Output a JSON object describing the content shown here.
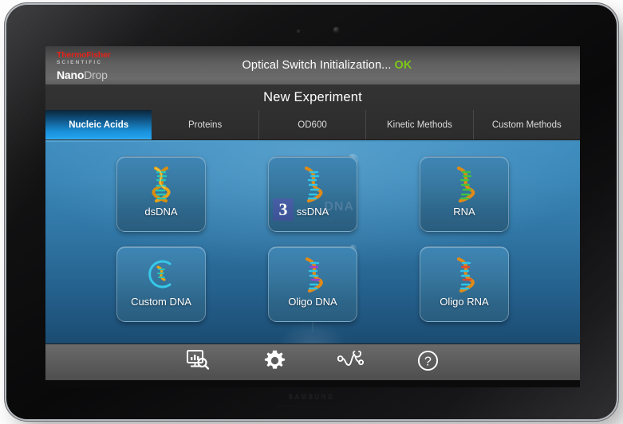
{
  "device": {
    "brand_wordmark": "SAMSUNG",
    "camera_icon": "camera-lens-icon",
    "sensor_icon": "proximity-sensor-icon"
  },
  "status_bar": {
    "logo": {
      "thermo": "ThermoFisher",
      "scientific": "SCIENTIFIC",
      "product_prefix": "Nano",
      "product_suffix": "Drop"
    },
    "message": "Optical Switch Initialization...",
    "state": "OK",
    "state_color": "#7cc61a"
  },
  "header": {
    "title": "New Experiment"
  },
  "tabs": [
    {
      "label": "Nucleic Acids",
      "active": true
    },
    {
      "label": "Proteins",
      "active": false
    },
    {
      "label": "OD600",
      "active": false
    },
    {
      "label": "Kinetic Methods",
      "active": false
    },
    {
      "label": "Custom Methods",
      "active": false
    }
  ],
  "tiles": [
    {
      "label": "dsDNA",
      "icon": "double-helix-gold-teal-icon"
    },
    {
      "label": "ssDNA",
      "icon": "single-helix-orange-teal-icon",
      "watermark_badge": "3",
      "watermark_ghost": "DNA"
    },
    {
      "label": "RNA",
      "icon": "single-helix-orange-green-icon"
    },
    {
      "label": "Custom DNA",
      "icon": "custom-dna-circle-helix-icon"
    },
    {
      "label": "Oligo DNA",
      "icon": "oligo-dna-helix-icon"
    },
    {
      "label": "Oligo RNA",
      "icon": "oligo-rna-helix-icon"
    }
  ],
  "toolbar": [
    {
      "icon": "data-review-monitor-search-icon",
      "name": "data-review-button"
    },
    {
      "icon": "gear-icon",
      "name": "settings-button"
    },
    {
      "icon": "stethoscope-icon",
      "name": "diagnostics-button"
    },
    {
      "icon": "question-mark-circle-icon",
      "name": "help-button"
    }
  ],
  "colors": {
    "accent_blue": "#23a6f2",
    "content_blue_top": "#3d8cbe",
    "content_blue_bottom": "#1b4c72",
    "toolbar_gray": "#5c5c5c",
    "status_gray": "#606060",
    "tab_dark": "#2e2e2e",
    "brand_red": "#e2231a",
    "ok_green": "#7cc61a"
  }
}
